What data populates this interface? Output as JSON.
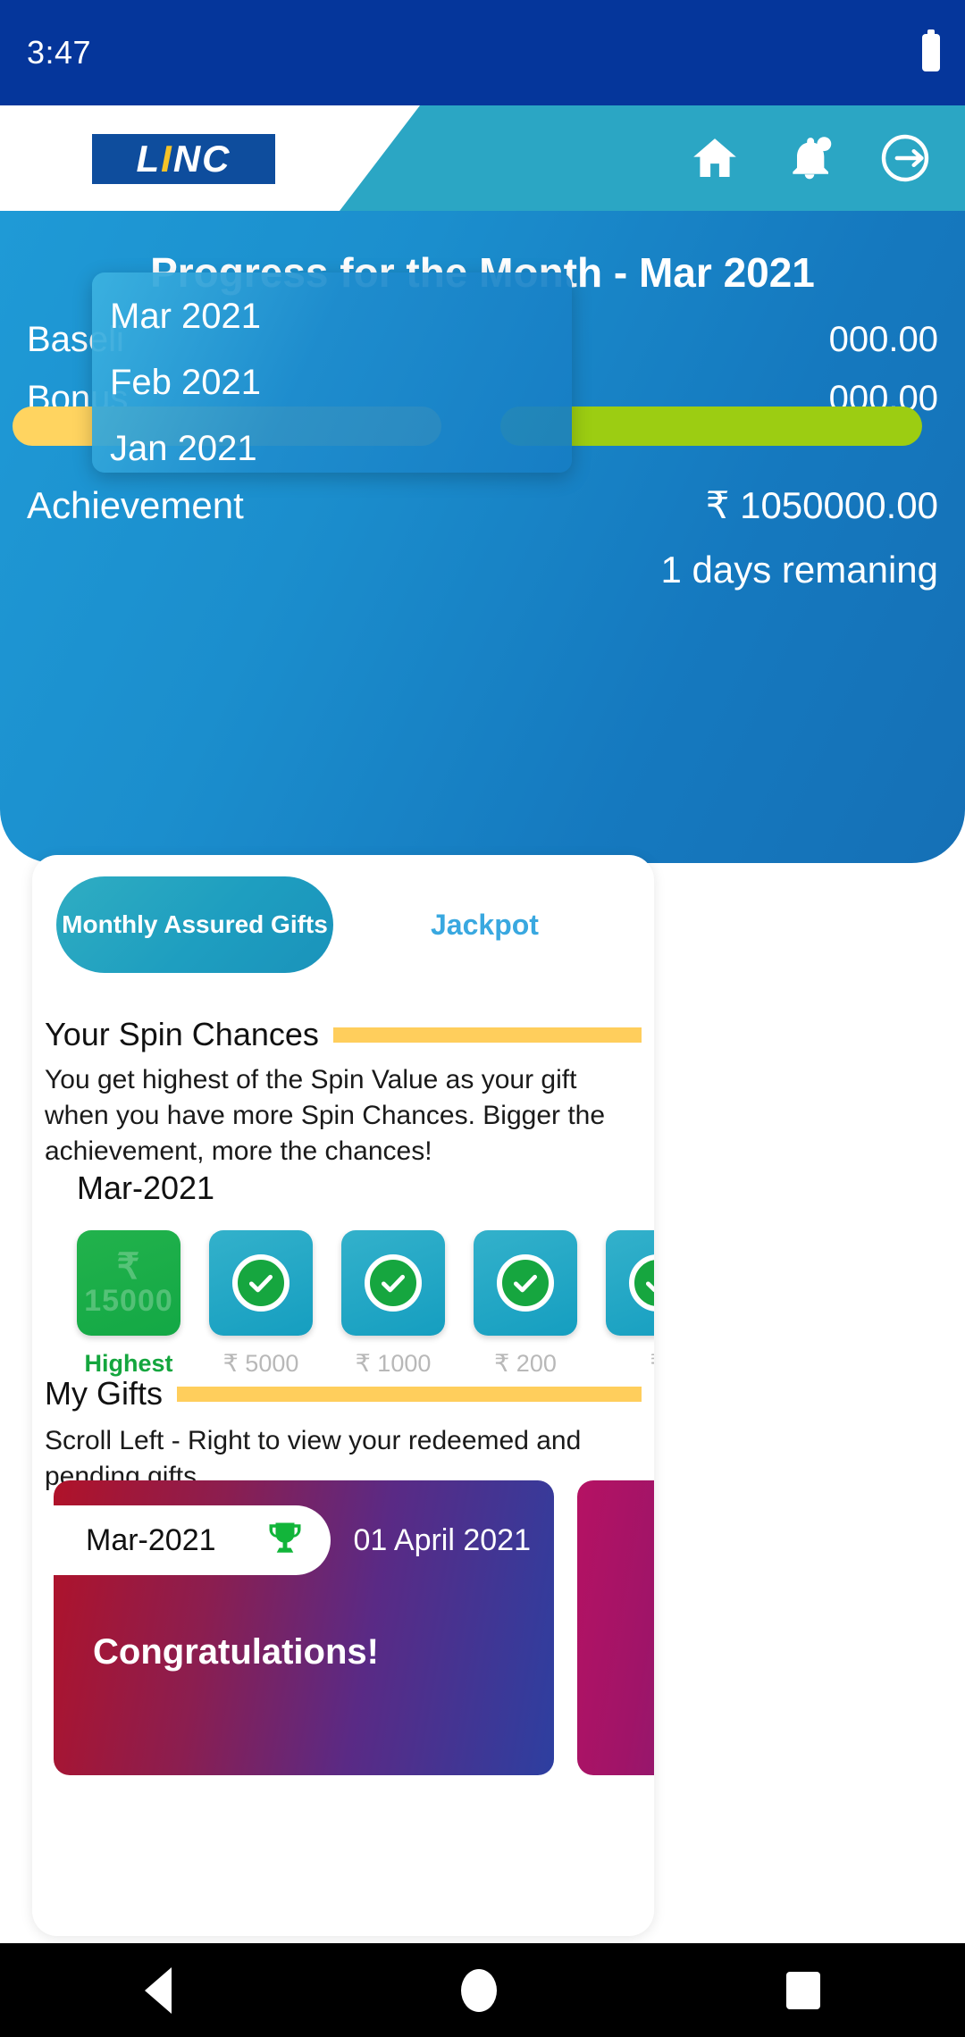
{
  "status_bar": {
    "clock": "3:47",
    "battery_icon": "battery-icon"
  },
  "app_bar": {
    "logo_text_1": "L",
    "logo_text_2": "I",
    "logo_text_3": "NC",
    "icons": [
      {
        "name": "home-icon"
      },
      {
        "name": "notification-bell-icon"
      },
      {
        "name": "logout-icon"
      }
    ]
  },
  "hero": {
    "title": "Progress for the Month - Mar 2021",
    "baseline_label": "Baseli",
    "baseline_value": "000.00",
    "bonus_label": "Bonus",
    "bonus_value": "000.00",
    "achievement_label": "Achievement",
    "achievement_value": "₹ 1050000.00",
    "days_remaining": "1 days remaning"
  },
  "month_dropdown": {
    "items": [
      {
        "label": "Mar 2021"
      },
      {
        "label": "Feb 2021"
      },
      {
        "label": "Jan 2021"
      }
    ]
  },
  "tabs": {
    "monthly_label": "Monthly Assured Gifts",
    "jackpot_label": "Jackpot"
  },
  "spin_section": {
    "heading": "Your Spin Chances",
    "body": "You get highest of the Spin Value as your gift when you have more Spin Chances. Bigger the achievement, more the chances!",
    "month": "Mar-2021",
    "tiles": [
      {
        "type": "highest",
        "watermark_symbol": "₹",
        "watermark_value": "15000",
        "label": "Highest"
      },
      {
        "type": "done",
        "icon": "check-circle-icon",
        "label": "₹ 5000"
      },
      {
        "type": "done",
        "icon": "check-circle-icon",
        "label": "₹ 1000"
      },
      {
        "type": "done",
        "icon": "check-circle-icon",
        "label": "₹ 200"
      },
      {
        "type": "done",
        "icon": "check-circle-icon",
        "label": "₹"
      }
    ]
  },
  "gifts_section": {
    "heading": "My Gifts",
    "body": "Scroll Left - Right to view your redeemed and pending gifts",
    "cards": [
      {
        "month": "Mar-2021",
        "trophy_icon": "trophy-icon",
        "date": "01 April 2021",
        "title": "Congratulations!"
      }
    ]
  },
  "nav_bar": {
    "back": "back-triangle-icon",
    "home": "home-circle-icon",
    "recent": "recent-square-icon"
  },
  "colors": {
    "status_bar": "#05369b",
    "app_bar": "#2ba6c4",
    "hero_gradient_start": "#1f9ad6",
    "hero_gradient_end": "#1570b6",
    "accent_yellow": "#ffce5c",
    "progress_yellow": "#ffd460",
    "progress_green": "#9ccd12",
    "tab_active": "#1e9ec0",
    "jackpot_text": "#39a8e0",
    "highest_green": "#14a63e",
    "logo_blue": "#0e4d9d",
    "logo_yellow": "#f6c328"
  }
}
